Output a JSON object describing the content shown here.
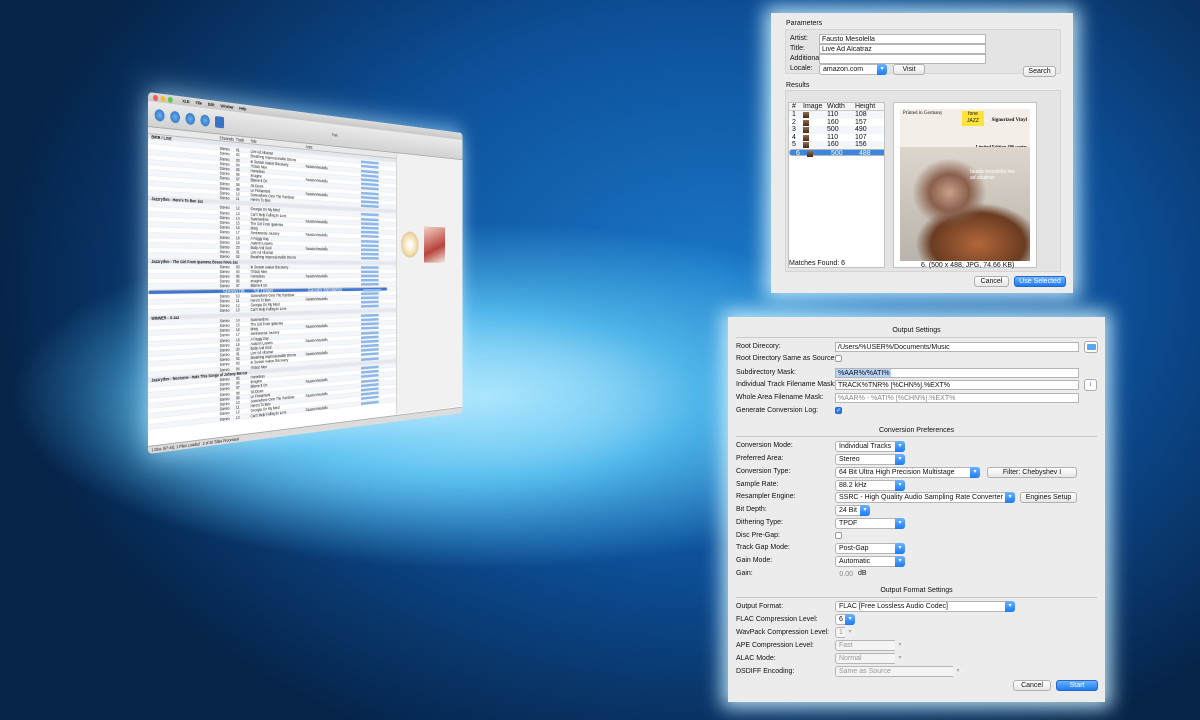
{
  "app": {
    "menu": [
      "XLD",
      "File",
      "Edit",
      "Window",
      "Help"
    ],
    "window_title": "Trak",
    "columns": [
      "",
      "Channels",
      "Track",
      "Title",
      "Artist",
      "",
      "",
      ""
    ],
    "group_rows": [
      "BIRR / LIVE",
      "Jazzrythm - Here's To Ben Jaz",
      "Jazzrythm - The Girl From Ipanema Bossa Nova Jaz",
      "WINNER - X-Jaz",
      "Jazzrythm - Nocturne - Hats This Songs of Johnny Mercer"
    ],
    "track_titles": [
      "Live Ad Alcatraz",
      "Breathing Impressionable Drums",
      "In Sunam Avatar Discovery",
      "I'll Bob Mee",
      "Homeless",
      "Imagine",
      "Blame It On",
      "Sit Down",
      "Le Firmament",
      "Somewhere Over The Rainbow",
      "Here's To Ben",
      "Georgia On My Mind",
      "Can't Help Falling In Love",
      "Summertime",
      "The Girl From Ipanema",
      "Misty",
      "Sentimental Journey",
      "A Foggy Day",
      "Autumn Leaves",
      "Body And Soul"
    ],
    "artist": "Fausto Mesolella",
    "status_text": "2 of 20 Titles Processed",
    "status_bottom": "1 Disc (67:44), 1 Files Loaded"
  },
  "search_dialog": {
    "section_title": "Parameters",
    "artist_label": "Artist:",
    "artist_value": "Fausto Mesolella",
    "title_label": "Title:",
    "title_value": "Live Ad Alcatraz",
    "additional_label": "Additional:",
    "additional_value": "",
    "locale_label": "Locale:",
    "locale_value": "amazon.com",
    "visit_label": "Visit",
    "search_label": "Search",
    "results_label": "Results",
    "columns": [
      "#",
      "Image",
      "Width",
      "Height"
    ],
    "rows": [
      {
        "n": "1",
        "w": "110",
        "h": "108"
      },
      {
        "n": "2",
        "w": "160",
        "h": "157"
      },
      {
        "n": "3",
        "w": "500",
        "h": "490"
      },
      {
        "n": "4",
        "w": "110",
        "h": "107"
      },
      {
        "n": "5",
        "w": "160",
        "h": "156"
      },
      {
        "n": "6",
        "w": "500",
        "h": "488"
      }
    ],
    "selected_row": 5,
    "matches_found": "Matches Found: 6",
    "image_info": "6. (500 x 488, JPG, 74.66 KB)",
    "cover_top_left": "Printed in Germany",
    "cover_logo": "fone JAZZ",
    "cover_vinyl": "Signorized Vinyl",
    "cover_limited": "Limited Edition 496 copies",
    "cover_name": "fausto mesolella live ad alcatraz",
    "cancel_label": "Cancel",
    "use_selected_label": "Use Selected"
  },
  "settings": {
    "output_title": "Output Settings",
    "root_dir_label": "Root Direcory:",
    "root_dir_value": "/Users/%USER%/Documents/Music",
    "root_same_label": "Root Directory Same as Source:",
    "subdir_label": "Subdirectory Mask:",
    "subdir_value": "%AAR%/%ATI%",
    "track_mask_label": "Individual Track Filename Mask:",
    "track_mask_value": "TRACK%TNR% [%CHN%].%EXT%",
    "whole_mask_label": "Whole Area Filename Mask:",
    "whole_mask_value": "%AAR% - %ATI% [%CHN%].%EXT%",
    "log_label": "Generate Conversion Log:",
    "conv_title": "Conversion Preferences",
    "conv_mode_label": "Conversion Mode:",
    "conv_mode_value": "Individual Tracks",
    "pref_area_label": "Preferred Area:",
    "pref_area_value": "Stereo",
    "conv_type_label": "Conversion Type:",
    "conv_type_value": "64 Bit Ultra High Precision Multistage",
    "filter_label": "Filter: Chebyshev I",
    "sample_rate_label": "Sample Rate:",
    "sample_rate_value": "88.2 kHz",
    "resampler_label": "Resampler Engine:",
    "resampler_value": "SSRC - High Quality Audio Sampling Rate Converter",
    "engines_setup_label": "Engines Setup",
    "bit_depth_label": "Bit Depth:",
    "bit_depth_value": "24 Bit",
    "dither_label": "Dithering Type:",
    "dither_value": "TPDF",
    "pregap_label": "Disc Pre-Gap:",
    "gap_mode_label": "Track Gap Mode:",
    "gap_mode_value": "Post-Gap",
    "gain_mode_label": "Gain Mode:",
    "gain_mode_value": "Automatic",
    "gain_label": "Gain:",
    "gain_value": "0.00",
    "gain_unit": "dB",
    "format_title": "Output Format Settings",
    "out_format_label": "Output Format:",
    "out_format_value": "FLAC [Free Lossless Audio Codec]",
    "flac_level_label": "FLAC Compression Level:",
    "flac_level_value": "6",
    "wavpack_label": "WavPack Compression Level:",
    "wavpack_value": "1",
    "ape_label": "APE Compression Level:",
    "ape_value": "Fast",
    "alac_label": "ALAC Mode:",
    "alac_value": "Normal",
    "dsdiff_label": "DSDIFF Encoding:",
    "dsdiff_value": "Same as Source",
    "cancel_label": "Cancel",
    "start_label": "Start"
  }
}
